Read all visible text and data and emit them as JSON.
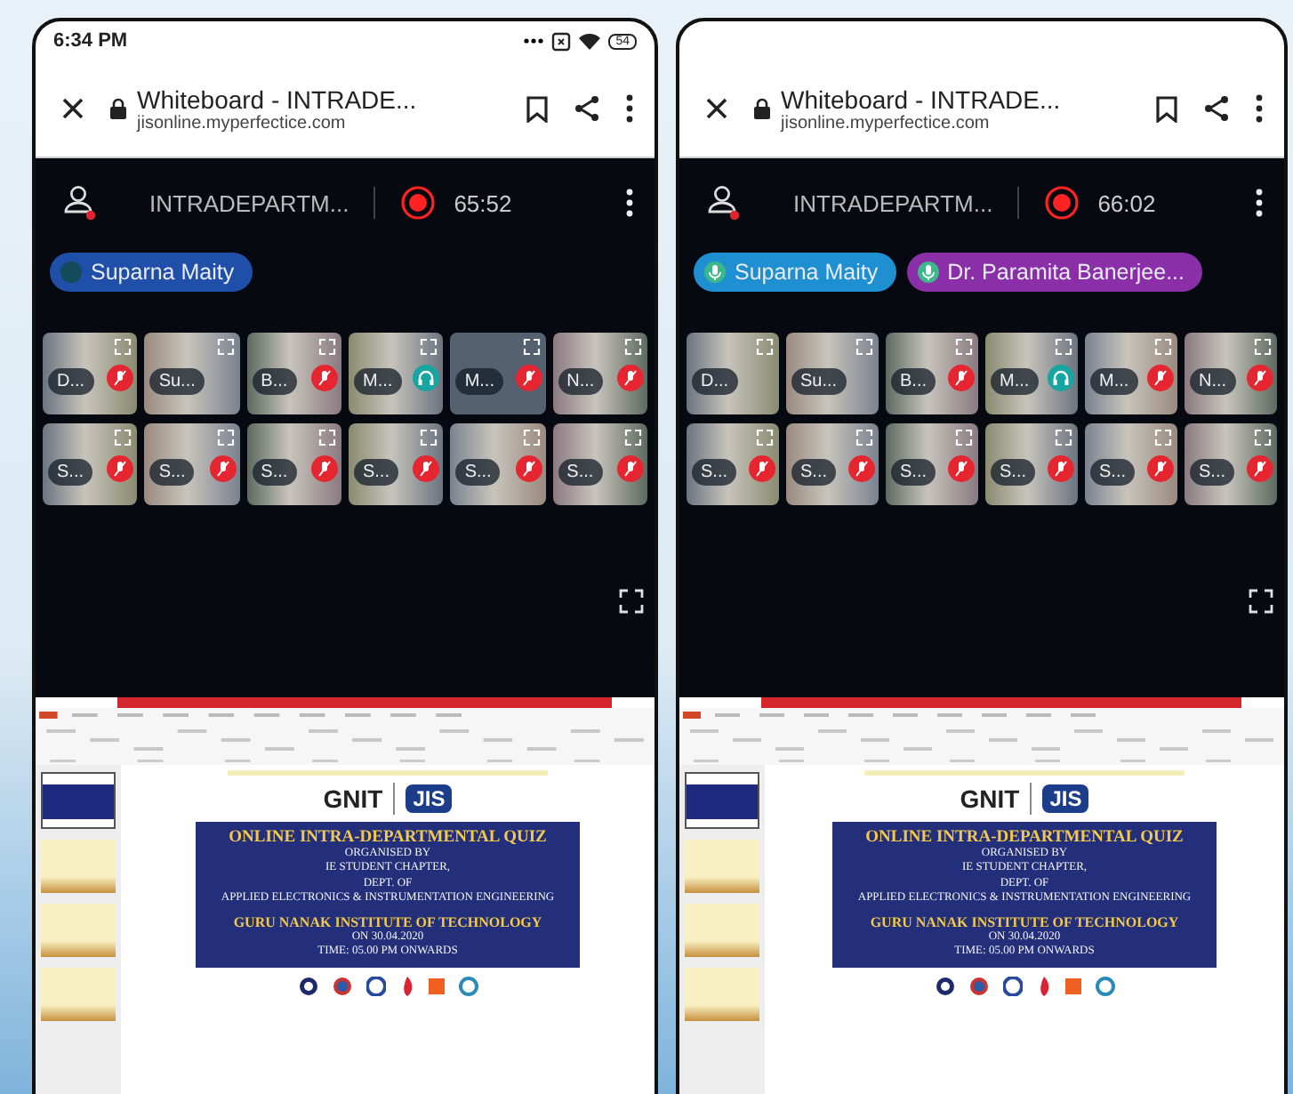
{
  "phones": [
    {
      "status_bar": {
        "time": "6:34 PM",
        "battery": "54"
      },
      "browser": {
        "title": "Whiteboard - INTRADE...",
        "url": "jisonline.myperfectice.com"
      },
      "meeting": {
        "title": "INTRADEPARTM...",
        "recording": true,
        "timer": "65:52"
      },
      "speakers": [
        {
          "name": "Suparna Maity",
          "color": "#1f4fa8",
          "mic": false
        }
      ],
      "tiles": [
        {
          "name": "D...",
          "video": true,
          "muted": true,
          "headphones": false
        },
        {
          "name": "Su...",
          "video": true,
          "muted": false,
          "headphones": false
        },
        {
          "name": "B...",
          "video": true,
          "muted": true,
          "headphones": false
        },
        {
          "name": "M...",
          "video": true,
          "muted": false,
          "headphones": true
        },
        {
          "name": "M...",
          "video": false,
          "muted": true,
          "headphones": false
        },
        {
          "name": "N...",
          "video": true,
          "muted": true,
          "headphones": false
        },
        {
          "name": "S...",
          "video": true,
          "muted": true,
          "headphones": false
        },
        {
          "name": "S...",
          "video": true,
          "muted": true,
          "headphones": false
        },
        {
          "name": "S...",
          "video": true,
          "muted": true,
          "headphones": false
        },
        {
          "name": "S...",
          "video": true,
          "muted": true,
          "headphones": false
        },
        {
          "name": "S...",
          "video": true,
          "muted": true,
          "headphones": false
        },
        {
          "name": "S...",
          "video": true,
          "muted": true,
          "headphones": false
        }
      ],
      "slide": {
        "logo_left": "GNIT",
        "logo_right": "JIS",
        "heading": "ONLINE INTRA-DEPARTMENTAL QUIZ",
        "lines": [
          "ORGANISED BY",
          "IE STUDENT CHAPTER,",
          "DEPT. OF",
          "APPLIED ELECTRONICS & INSTRUMENTATION ENGINEERING"
        ],
        "institute": "GURU NANAK INSTITUTE OF TECHNOLOGY",
        "date_lines": [
          "ON 30.04.2020",
          "TIME: 05.00 PM ONWARDS"
        ]
      }
    },
    {
      "browser": {
        "title": "Whiteboard - INTRADE...",
        "url": "jisonline.myperfectice.com"
      },
      "meeting": {
        "title": "INTRADEPARTM...",
        "recording": true,
        "timer": "66:02"
      },
      "speakers": [
        {
          "name": "Suparna Maity",
          "color": "#1e8fd0",
          "mic": true
        },
        {
          "name": "Dr. Paramita Banerjee...",
          "color": "#8a2fa8",
          "mic": true
        }
      ],
      "tiles": [
        {
          "name": "D...",
          "video": true,
          "muted": false,
          "headphones": false
        },
        {
          "name": "Su...",
          "video": true,
          "muted": false,
          "headphones": false
        },
        {
          "name": "B...",
          "video": true,
          "muted": true,
          "headphones": false
        },
        {
          "name": "M...",
          "video": true,
          "muted": false,
          "headphones": true
        },
        {
          "name": "M...",
          "video": true,
          "muted": true,
          "headphones": false
        },
        {
          "name": "N...",
          "video": true,
          "muted": true,
          "headphones": false
        },
        {
          "name": "S...",
          "video": true,
          "muted": true,
          "headphones": false
        },
        {
          "name": "S...",
          "video": true,
          "muted": true,
          "headphones": false
        },
        {
          "name": "S...",
          "video": true,
          "muted": true,
          "headphones": false
        },
        {
          "name": "S...",
          "video": true,
          "muted": true,
          "headphones": false
        },
        {
          "name": "S...",
          "video": true,
          "muted": true,
          "headphones": false
        },
        {
          "name": "S...",
          "video": true,
          "muted": true,
          "headphones": false
        }
      ],
      "slide": {
        "logo_left": "GNIT",
        "logo_right": "JIS",
        "heading": "ONLINE INTRA-DEPARTMENTAL QUIZ",
        "lines": [
          "ORGANISED BY",
          "IE STUDENT CHAPTER,",
          "DEPT. OF",
          "APPLIED ELECTRONICS & INSTRUMENTATION ENGINEERING"
        ],
        "institute": "GURU NANAK INSTITUTE OF TECHNOLOGY",
        "date_lines": [
          "ON 30.04.2020",
          "TIME: 05.00 PM ONWARDS"
        ]
      }
    }
  ]
}
